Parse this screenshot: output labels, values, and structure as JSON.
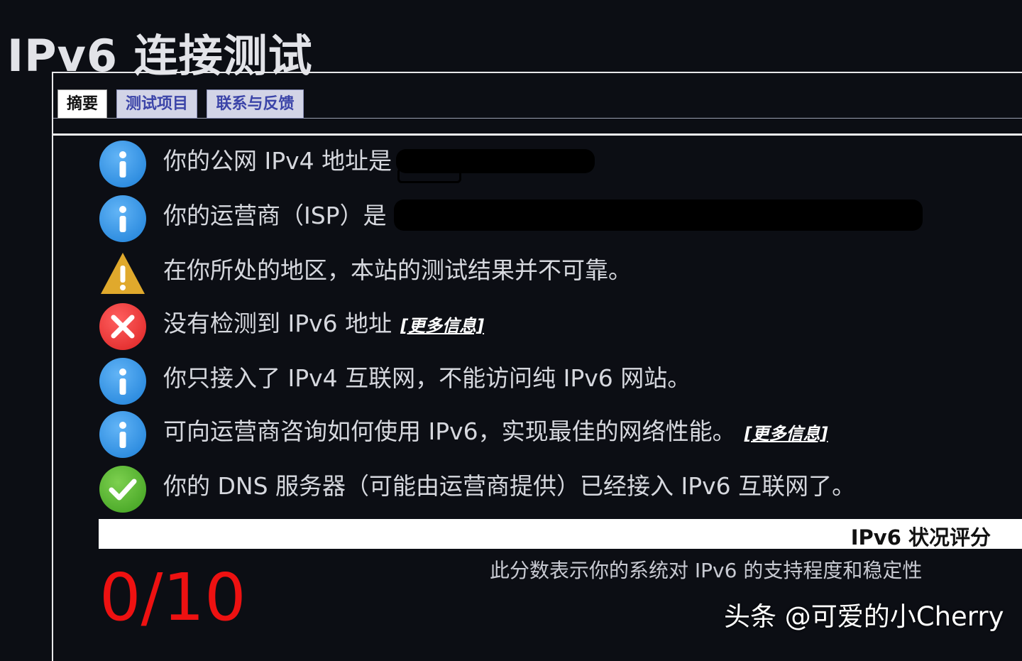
{
  "page": {
    "title": "IPv6 连接测试"
  },
  "tabs": [
    {
      "label": "摘要"
    },
    {
      "label": "测试项目"
    },
    {
      "label": "联系与反馈"
    }
  ],
  "results": [
    {
      "icon": "info-icon",
      "text": "你的公网 IPv4 地址是 "
    },
    {
      "icon": "info-icon",
      "text": "你的运营商（ISP）是 "
    },
    {
      "icon": "warning-icon",
      "text": "在你所处的地区，本站的测试结果并不可靠。"
    },
    {
      "icon": "error-icon",
      "text": "没有检测到 IPv6 地址",
      "link": "[更多信息]"
    },
    {
      "icon": "info-icon",
      "text": "你只接入了 IPv4 互联网，不能访问纯 IPv6 网站。"
    },
    {
      "icon": "info-icon",
      "text": "可向运营商咨询如何使用 IPv6，实现最佳的网络性能。",
      "link": "[更多信息]"
    },
    {
      "icon": "check-icon",
      "text": "你的 DNS 服务器（可能由运营商提供）已经接入 IPv6 互联网了。"
    }
  ],
  "score": {
    "label": "IPv6 状况评分",
    "description": "此分数表示你的系统对 IPv6 的支持程度和稳定性",
    "value": "0/10"
  },
  "watermark": "头条 @可爱的小Cherry",
  "colors": {
    "background": "#0c0e14",
    "info": "#2a8ce6",
    "error": "#e52a2a",
    "warning": "#e0a92c",
    "ok": "#4cae2a",
    "score": "#ee1111",
    "tab_link": "#3b44a8"
  }
}
